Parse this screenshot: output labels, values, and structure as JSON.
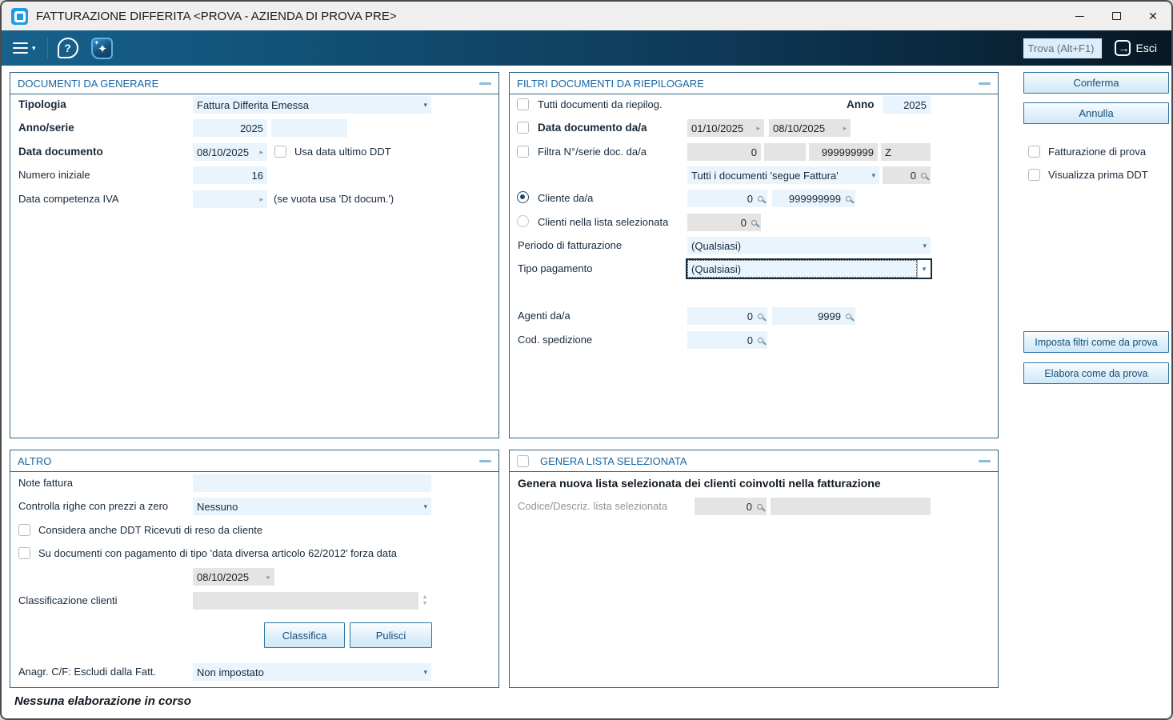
{
  "window": {
    "title": "FATTURAZIONE DIFFERITA <PROVA - AZIENDA DI PROVA PRE>"
  },
  "icons": {
    "caret_down": "▾",
    "arrow_right": "▸",
    "spinner_up": "▲",
    "spinner_down": "▼",
    "close": "✕",
    "question": "?",
    "exit_arrow": "→",
    "sparkle_large": "✦",
    "sparkle_small": "✦"
  },
  "toolbar": {
    "find_value": "Trova (Alt+F1)",
    "exit_label": "Esci"
  },
  "documenti": {
    "title": "DOCUMENTI DA GENERARE",
    "tipologia_label": "Tipologia",
    "tipologia_value": "Fattura Differita Emessa",
    "anno_serie_label": "Anno/serie",
    "anno_value": "2025",
    "serie_value": "",
    "data_documento_label": "Data documento",
    "data_documento_value": "08/10/2025",
    "usa_data_label": "Usa data ultimo DDT",
    "numero_iniziale_label": "Numero iniziale",
    "numero_iniziale_value": "16",
    "data_competenza_label": "Data competenza IVA",
    "data_competenza_value": "",
    "data_competenza_hint": "(se vuota usa 'Dt docum.')"
  },
  "filtri": {
    "title": "FILTRI DOCUMENTI DA RIEPILOGARE",
    "tutti_label": "Tutti documenti da riepilog.",
    "anno_label": "Anno",
    "anno_value": "2025",
    "data_label": "Data documento da/a",
    "data_da": "01/10/2025",
    "data_a": "08/10/2025",
    "numserie_label": "Filtra N°/serie doc. da/a",
    "num_da": "0",
    "serie_da": "",
    "num_a": "999999999",
    "serie_a": "Z",
    "segue_value": "Tutti i documenti 'segue Fattura'",
    "segue_num": "0",
    "cliente_label": "Cliente da/a",
    "cliente_da": "0",
    "cliente_a": "999999999",
    "clienti_lista_label": "Clienti nella lista selezionata",
    "clienti_lista_value": "0",
    "periodo_label": "Periodo di fatturazione",
    "periodo_value": "(Qualsiasi)",
    "tipo_pagamento_label": "Tipo pagamento",
    "tipo_pagamento_value": "(Qualsiasi)",
    "agenti_label": "Agenti da/a",
    "agenti_da": "0",
    "agenti_a": "9999",
    "cod_spedizione_label": "Cod. spedizione",
    "cod_spedizione_value": "0"
  },
  "right_actions": {
    "conferma": "Conferma",
    "annulla": "Annulla",
    "fatturazione_prova": "Fatturazione di prova",
    "visualizza_ddt": "Visualizza prima DDT",
    "imposta_filtri": "Imposta filtri come da prova",
    "elabora": "Elabora come da prova"
  },
  "altro": {
    "title": "ALTRO",
    "note_label": "Note fattura",
    "note_value": "",
    "controlla_label": "Controlla righe con prezzi a zero",
    "controlla_value": "Nessuno",
    "considera_label": "Considera anche DDT Ricevuti di reso da cliente",
    "forza_label": "Su documenti con pagamento di tipo 'data diversa articolo 62/2012' forza data",
    "forza_data_value": "08/10/2025",
    "classificazione_label": "Classificazione clienti",
    "classificazione_value": "",
    "classifica_btn": "Classifica",
    "pulisci_btn": "Pulisci",
    "anagr_label": "Anagr. C/F: Escludi dalla Fatt.",
    "anagr_value": "Non impostato"
  },
  "lista": {
    "title": "GENERA LISTA SELEZIONATA",
    "description": "Genera nuova lista selezionata dei clienti coinvolti nella fatturazione",
    "codice_label": "Codice/Descriz. lista selezionata",
    "codice_value": "0",
    "descrizione_value": ""
  },
  "statusbar": {
    "text": "Nessuna elaborazione in corso"
  },
  "colors": {
    "accent": "#1766a3",
    "field_blue": "#e9f4fc",
    "field_gray": "#e4e4e4",
    "toolbar_light": "#17618b",
    "toolbar_dark": "#081826",
    "app_icon_blue": "#1e9ce8",
    "button_text": "#174f78"
  }
}
